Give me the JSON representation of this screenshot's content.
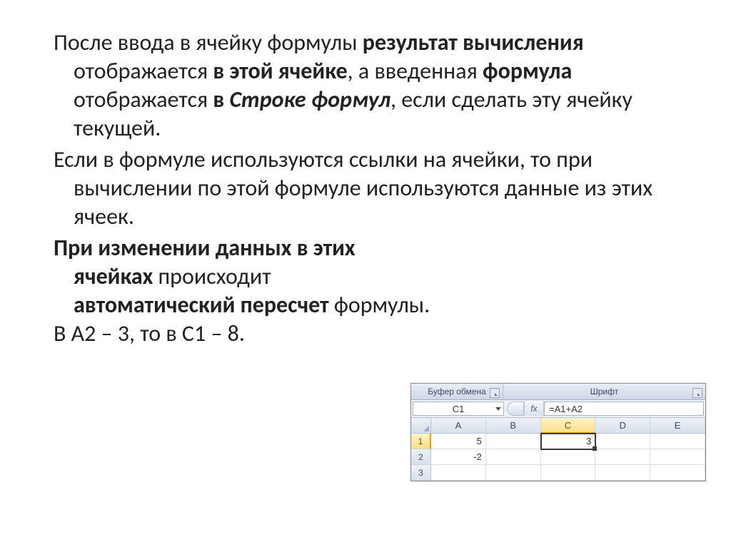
{
  "text": {
    "p1_a": "После ввода в ячейку формулы ",
    "p1_b": "результат вычисления",
    "p1_c": " отображается ",
    "p1_d": "в этой ячейке",
    "p1_e": ", а введенная ",
    "p1_f": "формула",
    "p1_g": " отображается ",
    "p1_h": "в ",
    "p1_i": "Строке формул",
    "p1_j": ", если сделать эту ячейку текущей.",
    "p2": "Если в формуле используются ссылки на ячейки, то при вычислении по этой формуле используются данные из этих ячеек.",
    "p3_a": "При изменении данных в этих ячейках",
    "p3_b": " происходит ",
    "p3_c": "автоматический пересчет",
    "p3_d": " формулы.",
    "p4": "В А2 – 3, то в С1 – 8."
  },
  "excel": {
    "ribbon_group_clipboard": "Буфер обмена",
    "ribbon_group_font": "Шрифт",
    "name_box": "C1",
    "fx_label": "fx",
    "formula": "=A1+A2",
    "columns": [
      "A",
      "B",
      "C",
      "D",
      "E"
    ],
    "rows": [
      "1",
      "2",
      "3"
    ],
    "cells": {
      "A1": "5",
      "A2": "-2",
      "C1": "3"
    },
    "active_cell": "C1"
  }
}
